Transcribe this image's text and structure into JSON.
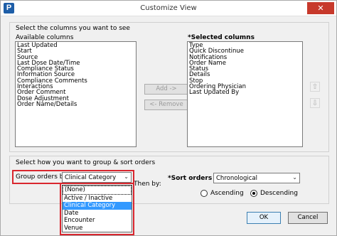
{
  "window": {
    "title": "Customize View",
    "app_icon": "P",
    "close_glyph": "✕"
  },
  "columns": {
    "prompt": "Select the columns you want to see",
    "available_label": "Available columns",
    "available": [
      "Last Updated",
      "Start",
      "Source",
      "Last Dose Date/Time",
      "Compliance Status",
      "Information Source",
      "Compliance Comments",
      "Interactions",
      "Order Comment",
      "Dose Adjustment",
      "Order Name/Details"
    ],
    "selected_label": "*Selected columns",
    "selected": [
      "Type",
      "Quick Discontinue",
      "Notifications",
      "Order Name",
      "Status",
      "Details",
      "Stop",
      "Ordering Physician",
      "Last Updated By"
    ],
    "add_label": "Add ->",
    "remove_label": "<- Remove",
    "up_icon": "⇧",
    "down_icon": "⇩"
  },
  "grouping": {
    "prompt": "Select how you want to group & sort orders",
    "group_label": "Group orders by:",
    "group_value": "Clinical Category",
    "then_label": "Then by:",
    "options": [
      "(None)",
      "Active / Inactive",
      "Clinical Category",
      "Date",
      "Encounter",
      "Venue"
    ],
    "selected_index": 2,
    "sort_label": "*Sort orders by:",
    "sort_value": "Chronological",
    "ascending_label": "Ascending",
    "descending_label": "Descending",
    "sort_direction": "Descending",
    "chevron": "⌄"
  },
  "footer": {
    "ok_label": "OK",
    "cancel_label": "Cancel"
  }
}
